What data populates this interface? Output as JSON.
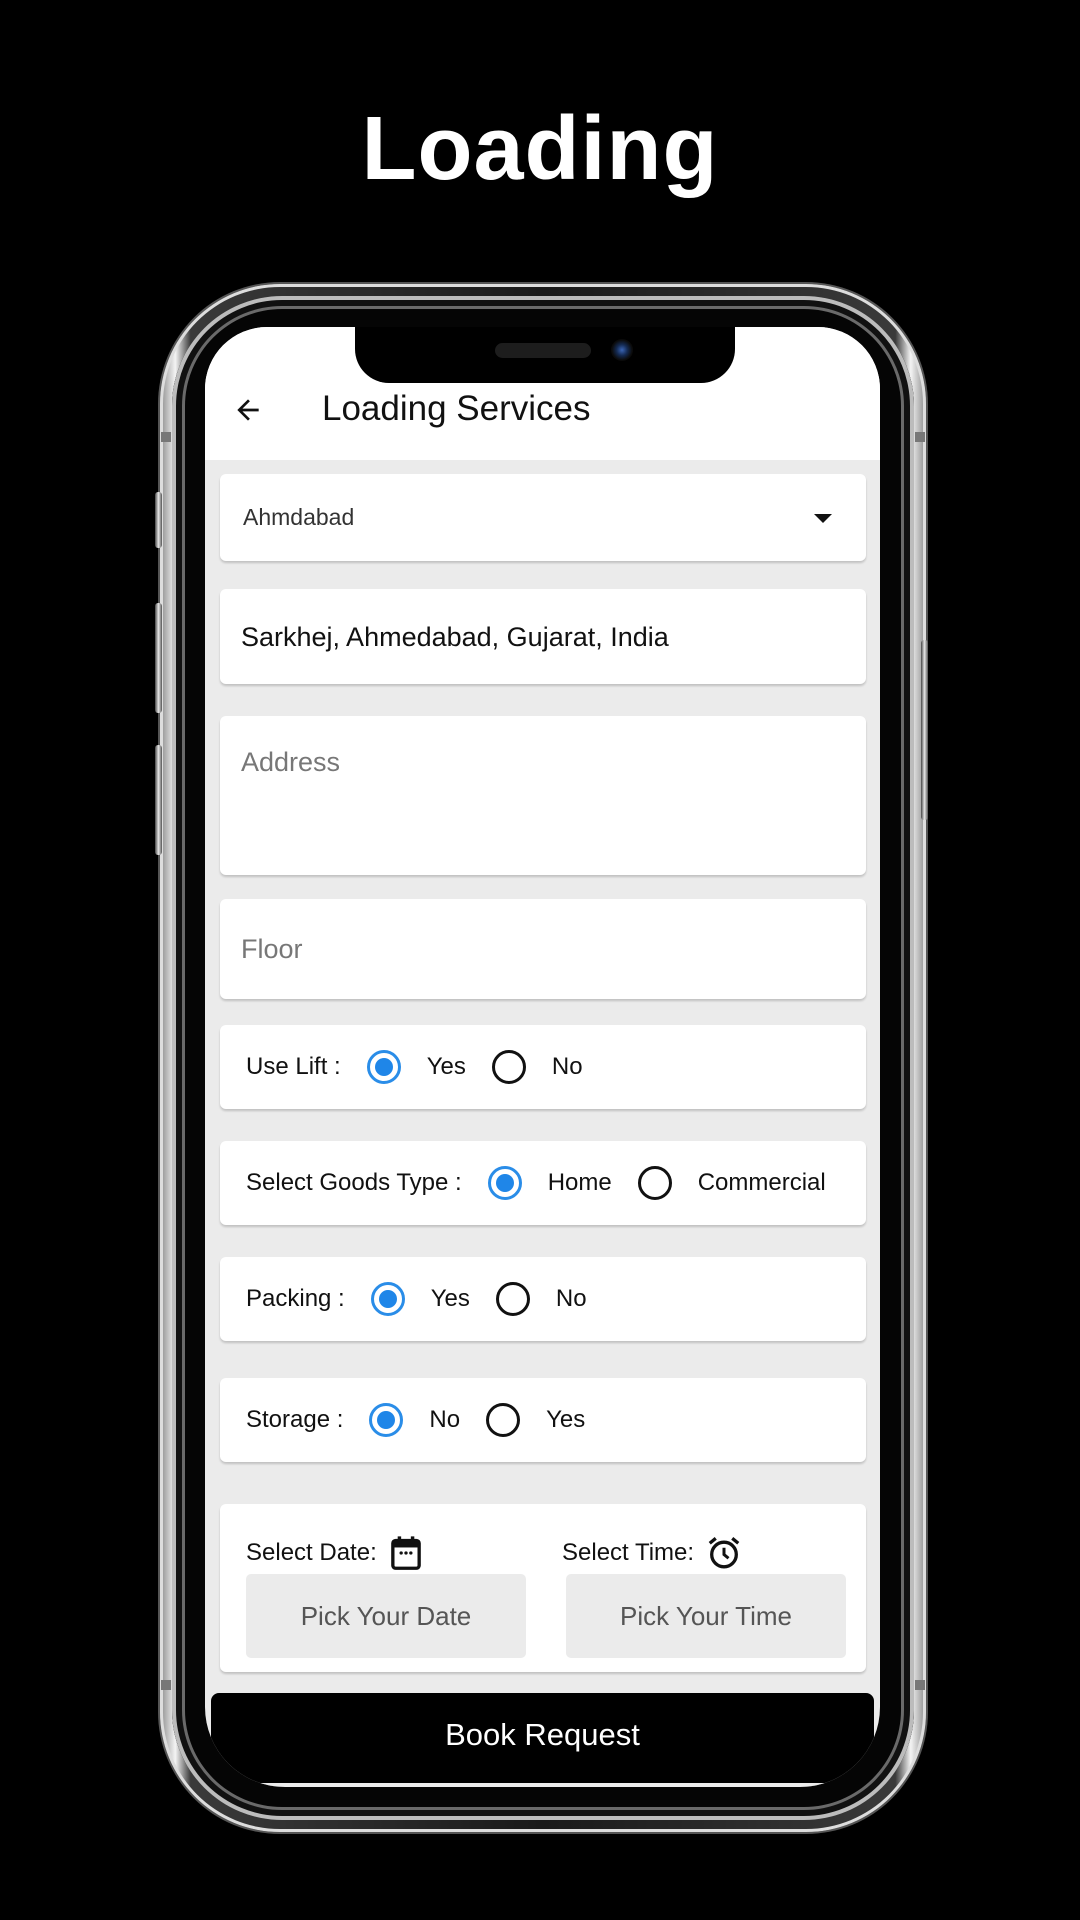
{
  "promo": {
    "title": "Loading"
  },
  "appbar": {
    "title": "Loading Services",
    "back_icon": "arrow-left-icon"
  },
  "city_dropdown": {
    "selected": "Ahmdabad"
  },
  "location_field": {
    "value": "Sarkhej, Ahmedabad, Gujarat, India"
  },
  "address_field": {
    "placeholder": "Address"
  },
  "floor_field": {
    "placeholder": "Floor"
  },
  "use_lift": {
    "label": "Use Lift :",
    "options": [
      {
        "label": "Yes",
        "checked": true
      },
      {
        "label": "No",
        "checked": false
      }
    ]
  },
  "goods_type": {
    "label": "Select Goods Type :",
    "options": [
      {
        "label": "Home",
        "checked": true
      },
      {
        "label": "Commercial",
        "checked": false
      }
    ]
  },
  "packing": {
    "label": "Packing :",
    "options": [
      {
        "label": "Yes",
        "checked": true
      },
      {
        "label": "No",
        "checked": false
      }
    ]
  },
  "storage": {
    "label": "Storage :",
    "options": [
      {
        "label": "No",
        "checked": true
      },
      {
        "label": "Yes",
        "checked": false
      }
    ]
  },
  "date_time": {
    "date_label": "Select Date:",
    "time_label": "Select Time:",
    "date_button": "Pick Your Date",
    "time_button": "Pick Your Time",
    "date_icon": "calendar-icon",
    "time_icon": "alarm-clock-icon"
  },
  "book_button": {
    "label": "Book Request"
  },
  "colors": {
    "accent": "#1f86e8",
    "background": "#ebebeb",
    "card": "#ffffff",
    "primary_button": "#000000"
  }
}
